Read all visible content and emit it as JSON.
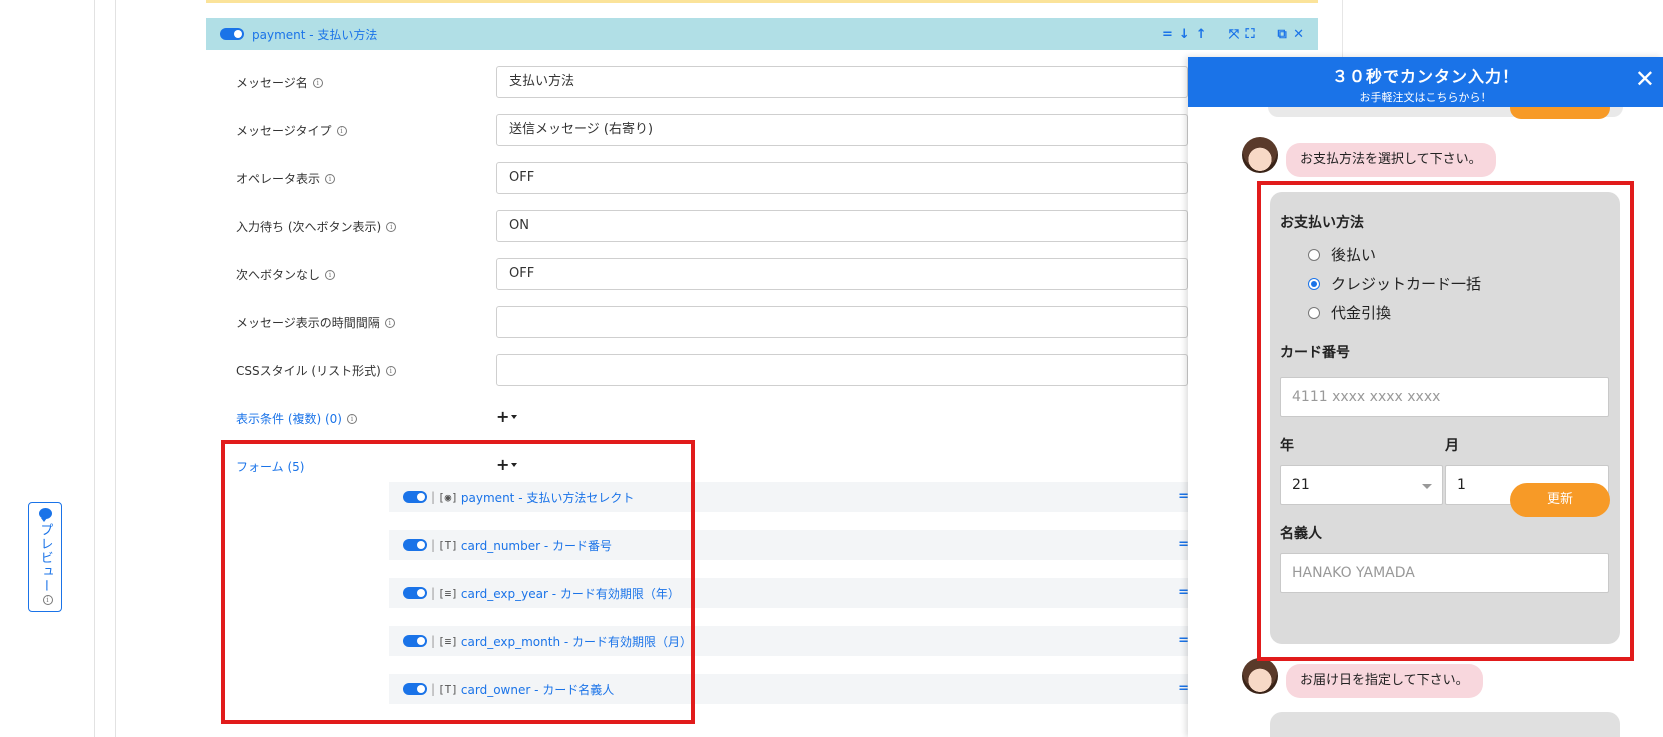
{
  "preview_tab": {
    "label": "プレビュー"
  },
  "header": {
    "title": "payment - 支払い方法",
    "tools": [
      "=",
      "↓",
      "↑",
      "⤧",
      "⛶",
      "⧉",
      "✕"
    ]
  },
  "fields": [
    {
      "label": "メッセージ名",
      "value": "支払い方法"
    },
    {
      "label": "メッセージタイプ",
      "value": "送信メッセージ (右寄り)"
    },
    {
      "label": "オペレータ表示",
      "value": "OFF"
    },
    {
      "label": "入力待ち (次へボタン表示)",
      "value": "ON"
    },
    {
      "label": "次へボタンなし",
      "value": "OFF"
    },
    {
      "label": "メッセージ表示の時間間隔",
      "value": ""
    },
    {
      "label": "CSSスタイル (リスト形式)",
      "value": ""
    }
  ],
  "conditions": {
    "label": "表示条件 (複数) (0)",
    "add": "+"
  },
  "forms": {
    "label": "フォーム (5)",
    "add": "+",
    "items": [
      {
        "type": "[◉]",
        "name": "payment - 支払い方法セレクト"
      },
      {
        "type": "[T]",
        "name": "card_number - カード番号"
      },
      {
        "type": "[≡]",
        "name": "card_exp_year - カード有効期限（年）"
      },
      {
        "type": "[≡]",
        "name": "card_exp_month - カード有効期限（月）"
      },
      {
        "type": "[T]",
        "name": "card_owner - カード名義人"
      }
    ],
    "drag_handle": "="
  },
  "chat": {
    "title": "３０秒でカンタン入力！",
    "subtitle": "お手軽注文はこちらから！",
    "close": "✕",
    "message1": "お支払方法を選択して下さい。",
    "form": {
      "payment_label": "お支払い方法",
      "options": [
        "後払い",
        "クレジットカード一括",
        "代金引換"
      ],
      "selected_index": 1,
      "card_number_label": "カード番号",
      "card_number_placeholder": "4111 xxxx xxxx xxxx",
      "year_label": "年",
      "month_label": "月",
      "year_value": "21",
      "month_value": "1",
      "owner_label": "名義人",
      "owner_placeholder": "HANAKO YAMADA",
      "update_button": "更新"
    },
    "message2": "お届け日を指定して下さい。"
  },
  "colors": {
    "accent": "#1a73e8",
    "header_bg": "#b1dfe6",
    "highlight": "#e11b1b",
    "button": "#f79a27",
    "bubble": "#f8d7dd"
  }
}
